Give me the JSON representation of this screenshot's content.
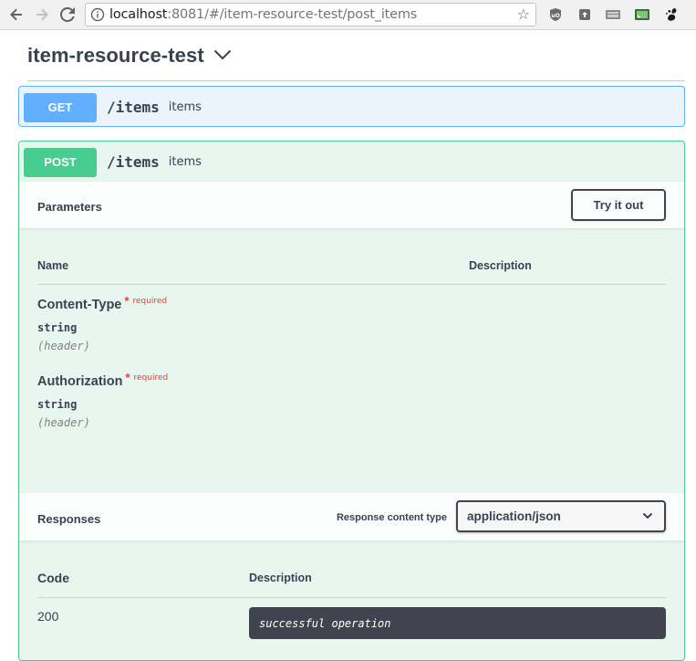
{
  "browser": {
    "url_host": "localhost",
    "url_rest": ":8081/#/item-resource-test/post_items"
  },
  "page": {
    "title": "item-resource-test"
  },
  "get_op": {
    "method": "GET",
    "path": "/items",
    "summary": "items"
  },
  "post_op": {
    "method": "POST",
    "path": "/items",
    "summary": "items",
    "parameters": {
      "title": "Parameters",
      "try_label": "Try it out",
      "col_name": "Name",
      "col_description": "Description",
      "items": [
        {
          "name": "Content-Type",
          "star": "*",
          "required": "required",
          "type": "string",
          "in": "(header)"
        },
        {
          "name": "Authorization",
          "star": "*",
          "required": "required",
          "type": "string",
          "in": "(header)"
        }
      ]
    },
    "responses": {
      "title": "Responses",
      "content_type_label": "Response content type",
      "content_type_value": "application/json",
      "col_code": "Code",
      "col_description": "Description",
      "rows": [
        {
          "code": "200",
          "description": "successful operation"
        }
      ]
    }
  }
}
